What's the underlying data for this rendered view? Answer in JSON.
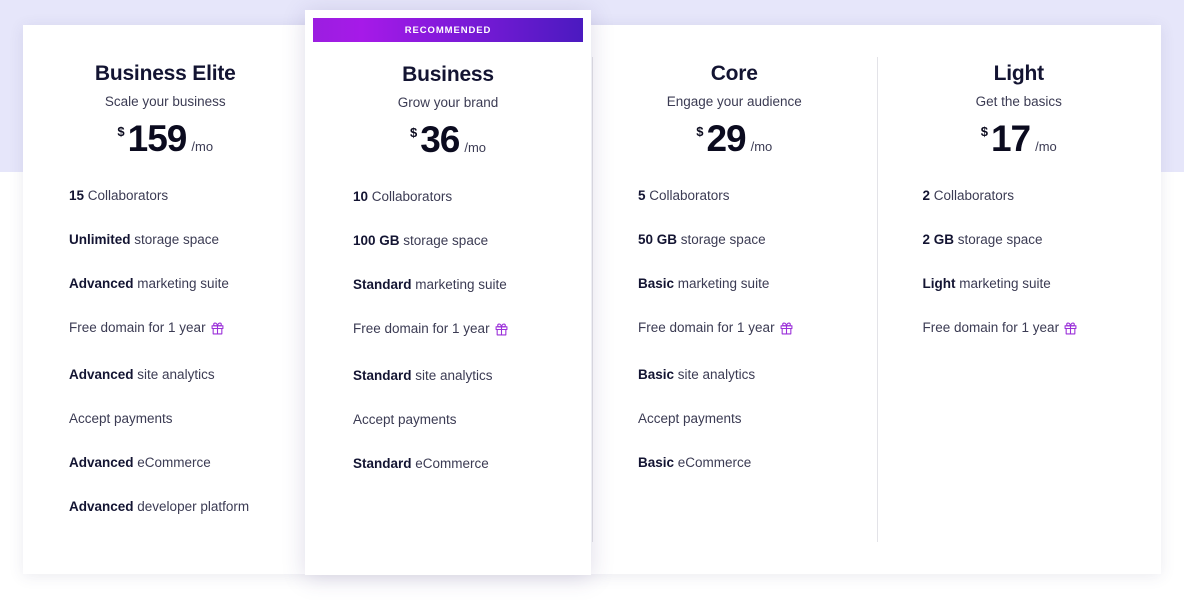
{
  "theme": {
    "page_background": "#ffffff",
    "band_background": "#e6e6fa",
    "card_background": "#ffffff",
    "accent_gradient_start": "#9b1ee0",
    "accent_gradient_end": "#4b1ac0",
    "heading_color": "#131432",
    "body_color": "#3b3b53",
    "divider_color": "#e3e3e8",
    "gift_icon_color": "#9b30d9"
  },
  "badge": {
    "label": "RECOMMENDED"
  },
  "currency_symbol": "$",
  "period_label": "/mo",
  "gift_icon_name": "gift-icon",
  "plans": [
    {
      "id": "business-elite",
      "name": "Business Elite",
      "tagline": "Scale your business",
      "price": "159",
      "recommended": false,
      "features": [
        {
          "strong": "15",
          "rest": " Collaborators",
          "gift": false
        },
        {
          "strong": "Unlimited",
          "rest": " storage space",
          "gift": false
        },
        {
          "strong": "Advanced",
          "rest": " marketing suite",
          "gift": false
        },
        {
          "strong": "",
          "rest": "Free domain for 1 year",
          "gift": true
        },
        {
          "strong": "Advanced",
          "rest": " site analytics",
          "gift": false
        },
        {
          "strong": "",
          "rest": "Accept payments",
          "gift": false
        },
        {
          "strong": "Advanced",
          "rest": " eCommerce",
          "gift": false
        },
        {
          "strong": "Advanced",
          "rest": " developer platform",
          "gift": false
        }
      ]
    },
    {
      "id": "business",
      "name": "Business",
      "tagline": "Grow your brand",
      "price": "36",
      "recommended": true,
      "features": [
        {
          "strong": "10",
          "rest": " Collaborators",
          "gift": false
        },
        {
          "strong": "100 GB",
          "rest": " storage space",
          "gift": false
        },
        {
          "strong": "Standard",
          "rest": " marketing suite",
          "gift": false
        },
        {
          "strong": "",
          "rest": "Free domain for 1 year",
          "gift": true
        },
        {
          "strong": "Standard",
          "rest": " site analytics",
          "gift": false
        },
        {
          "strong": "",
          "rest": "Accept payments",
          "gift": false
        },
        {
          "strong": "Standard",
          "rest": " eCommerce",
          "gift": false
        }
      ]
    },
    {
      "id": "core",
      "name": "Core",
      "tagline": "Engage your audience",
      "price": "29",
      "recommended": false,
      "features": [
        {
          "strong": "5",
          "rest": " Collaborators",
          "gift": false
        },
        {
          "strong": "50 GB",
          "rest": " storage space",
          "gift": false
        },
        {
          "strong": "Basic",
          "rest": " marketing suite",
          "gift": false
        },
        {
          "strong": "",
          "rest": "Free domain for 1 year",
          "gift": true
        },
        {
          "strong": "Basic",
          "rest": " site analytics",
          "gift": false
        },
        {
          "strong": "",
          "rest": "Accept payments",
          "gift": false
        },
        {
          "strong": "Basic",
          "rest": " eCommerce",
          "gift": false
        }
      ]
    },
    {
      "id": "light",
      "name": "Light",
      "tagline": "Get the basics",
      "price": "17",
      "recommended": false,
      "features": [
        {
          "strong": "2",
          "rest": " Collaborators",
          "gift": false
        },
        {
          "strong": "2 GB",
          "rest": " storage space",
          "gift": false
        },
        {
          "strong": "Light",
          "rest": " marketing suite",
          "gift": false
        },
        {
          "strong": "",
          "rest": "Free domain for 1 year",
          "gift": true
        }
      ]
    }
  ]
}
